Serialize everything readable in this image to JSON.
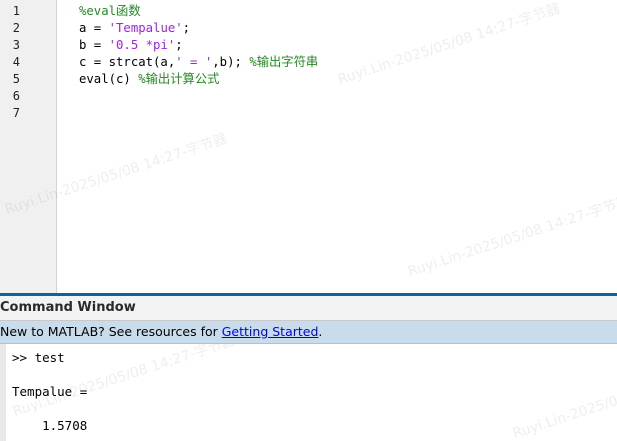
{
  "editor": {
    "line_numbers": [
      "1",
      "2",
      "3",
      "4",
      "5",
      "6",
      "7"
    ],
    "lines": [
      {
        "segments": [
          {
            "text": "%eval函数",
            "kind": "comment"
          }
        ]
      },
      {
        "segments": [
          {
            "text": "a = ",
            "kind": "code"
          },
          {
            "text": "'Tempalue'",
            "kind": "string"
          },
          {
            "text": ";",
            "kind": "code"
          }
        ]
      },
      {
        "segments": [
          {
            "text": "b = ",
            "kind": "code"
          },
          {
            "text": "'0.5 *pi'",
            "kind": "string"
          },
          {
            "text": ";",
            "kind": "code"
          }
        ]
      },
      {
        "segments": [
          {
            "text": "c = strcat(a,",
            "kind": "code"
          },
          {
            "text": "' = '",
            "kind": "string"
          },
          {
            "text": ",b); ",
            "kind": "code"
          },
          {
            "text": "%输出字符串",
            "kind": "comment"
          }
        ]
      },
      {
        "segments": [
          {
            "text": "eval(c) ",
            "kind": "code"
          },
          {
            "text": "%输出计算公式",
            "kind": "comment"
          }
        ]
      },
      {
        "segments": []
      },
      {
        "segments": []
      }
    ],
    "watermark": "Ruyi.Lin-2025/05/08 14:27-字节器"
  },
  "command_window": {
    "title": "Command Window",
    "banner": {
      "prefix": "New to MATLAB? See resources for ",
      "link": "Getting Started",
      "suffix": "."
    },
    "lines": [
      ">> test",
      "",
      "Tempalue =",
      "",
      "    1.5708"
    ]
  },
  "colors": {
    "comment": "#228b22",
    "string": "#a020f0",
    "accent_border": "#0a64a4",
    "banner_bg": "#c8dcec",
    "link": "#0000ee"
  }
}
